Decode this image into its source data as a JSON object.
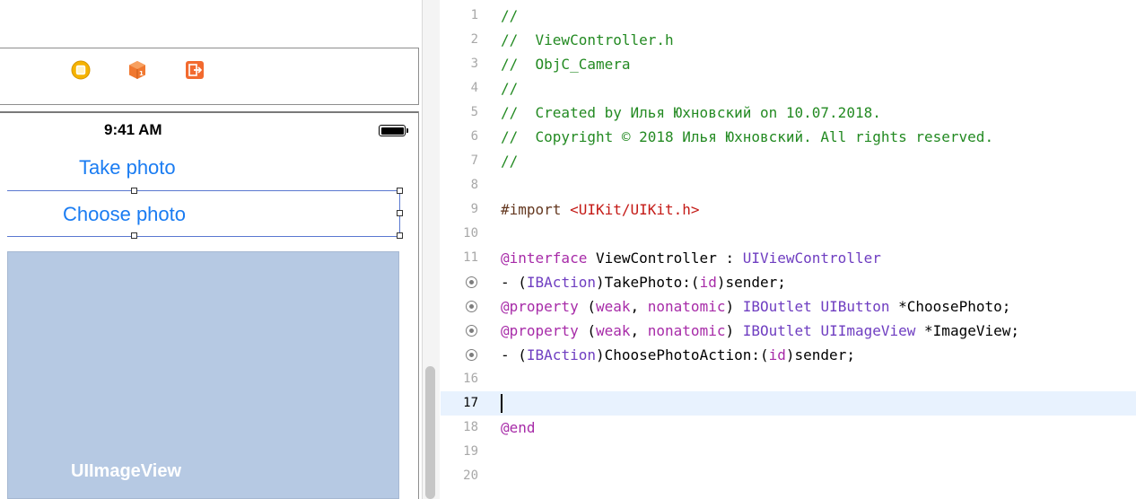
{
  "interface_builder": {
    "dock_icons": [
      "view-controller-icon",
      "first-responder-icon",
      "exit-icon"
    ],
    "status_bar": {
      "time": "9:41 AM"
    },
    "buttons": {
      "take_photo": "Take photo",
      "choose_photo": "Choose photo"
    },
    "image_view": {
      "label": "UIImageView"
    },
    "colors": {
      "button_tint": "#1a7cf2",
      "image_view_bg": "#b6c9e3",
      "selection": "#5a78d0"
    }
  },
  "editor": {
    "current_line": 17,
    "lines": [
      {
        "n": "1",
        "connector": false,
        "tokens": [
          {
            "t": "//",
            "c": "comment"
          }
        ]
      },
      {
        "n": "2",
        "connector": false,
        "tokens": [
          {
            "t": "//  ViewController.h",
            "c": "comment"
          }
        ]
      },
      {
        "n": "3",
        "connector": false,
        "tokens": [
          {
            "t": "//  ObjC_Camera",
            "c": "comment"
          }
        ]
      },
      {
        "n": "4",
        "connector": false,
        "tokens": [
          {
            "t": "//",
            "c": "comment"
          }
        ]
      },
      {
        "n": "5",
        "connector": false,
        "tokens": [
          {
            "t": "//  Created by Илья Юхновский on 10.07.2018.",
            "c": "comment"
          }
        ]
      },
      {
        "n": "6",
        "connector": false,
        "tokens": [
          {
            "t": "//  Copyright © 2018 Илья Юхновский. All rights reserved.",
            "c": "comment"
          }
        ]
      },
      {
        "n": "7",
        "connector": false,
        "tokens": [
          {
            "t": "//",
            "c": "comment"
          }
        ]
      },
      {
        "n": "8",
        "connector": false,
        "tokens": []
      },
      {
        "n": "9",
        "connector": false,
        "tokens": [
          {
            "t": "#import ",
            "c": "directive"
          },
          {
            "t": "<UIKit/UIKit.h>",
            "c": "string"
          }
        ]
      },
      {
        "n": "10",
        "connector": false,
        "tokens": []
      },
      {
        "n": "11",
        "connector": false,
        "tokens": [
          {
            "t": "@interface",
            "c": "keyword"
          },
          {
            "t": " ViewController : ",
            "c": "plain"
          },
          {
            "t": "UIViewController",
            "c": "type"
          }
        ]
      },
      {
        "n": "",
        "connector": true,
        "tokens": [
          {
            "t": "- (",
            "c": "plain"
          },
          {
            "t": "IBAction",
            "c": "type"
          },
          {
            "t": ")TakePhoto:(",
            "c": "plain"
          },
          {
            "t": "id",
            "c": "keyword"
          },
          {
            "t": ")sender;",
            "c": "plain"
          }
        ]
      },
      {
        "n": "",
        "connector": true,
        "tokens": [
          {
            "t": "@property",
            "c": "keyword"
          },
          {
            "t": " (",
            "c": "plain"
          },
          {
            "t": "weak",
            "c": "keyword"
          },
          {
            "t": ", ",
            "c": "plain"
          },
          {
            "t": "nonatomic",
            "c": "keyword"
          },
          {
            "t": ") ",
            "c": "plain"
          },
          {
            "t": "IBOutlet",
            "c": "type"
          },
          {
            "t": " ",
            "c": "plain"
          },
          {
            "t": "UIButton",
            "c": "type"
          },
          {
            "t": " *ChoosePhoto;",
            "c": "plain"
          }
        ]
      },
      {
        "n": "",
        "connector": true,
        "tokens": [
          {
            "t": "@property",
            "c": "keyword"
          },
          {
            "t": " (",
            "c": "plain"
          },
          {
            "t": "weak",
            "c": "keyword"
          },
          {
            "t": ", ",
            "c": "plain"
          },
          {
            "t": "nonatomic",
            "c": "keyword"
          },
          {
            "t": ") ",
            "c": "plain"
          },
          {
            "t": "IBOutlet",
            "c": "type"
          },
          {
            "t": " ",
            "c": "plain"
          },
          {
            "t": "UIImageView",
            "c": "type"
          },
          {
            "t": " *ImageView;",
            "c": "plain"
          }
        ]
      },
      {
        "n": "",
        "connector": true,
        "tokens": [
          {
            "t": "- (",
            "c": "plain"
          },
          {
            "t": "IBAction",
            "c": "type"
          },
          {
            "t": ")ChoosePhotoAction:(",
            "c": "plain"
          },
          {
            "t": "id",
            "c": "keyword"
          },
          {
            "t": ")sender;",
            "c": "plain"
          }
        ]
      },
      {
        "n": "16",
        "connector": false,
        "tokens": []
      },
      {
        "n": "17",
        "connector": false,
        "tokens": []
      },
      {
        "n": "18",
        "connector": false,
        "tokens": [
          {
            "t": "@end",
            "c": "keyword"
          }
        ]
      },
      {
        "n": "19",
        "connector": false,
        "tokens": []
      },
      {
        "n": "20",
        "connector": false,
        "tokens": []
      }
    ],
    "colors": {
      "comment": "#238a22",
      "string": "#c41a16",
      "keyword": "#a72ba8",
      "type": "#6f3ec1",
      "directive": "#643820",
      "current_line_bg": "#e8f2fe"
    }
  }
}
